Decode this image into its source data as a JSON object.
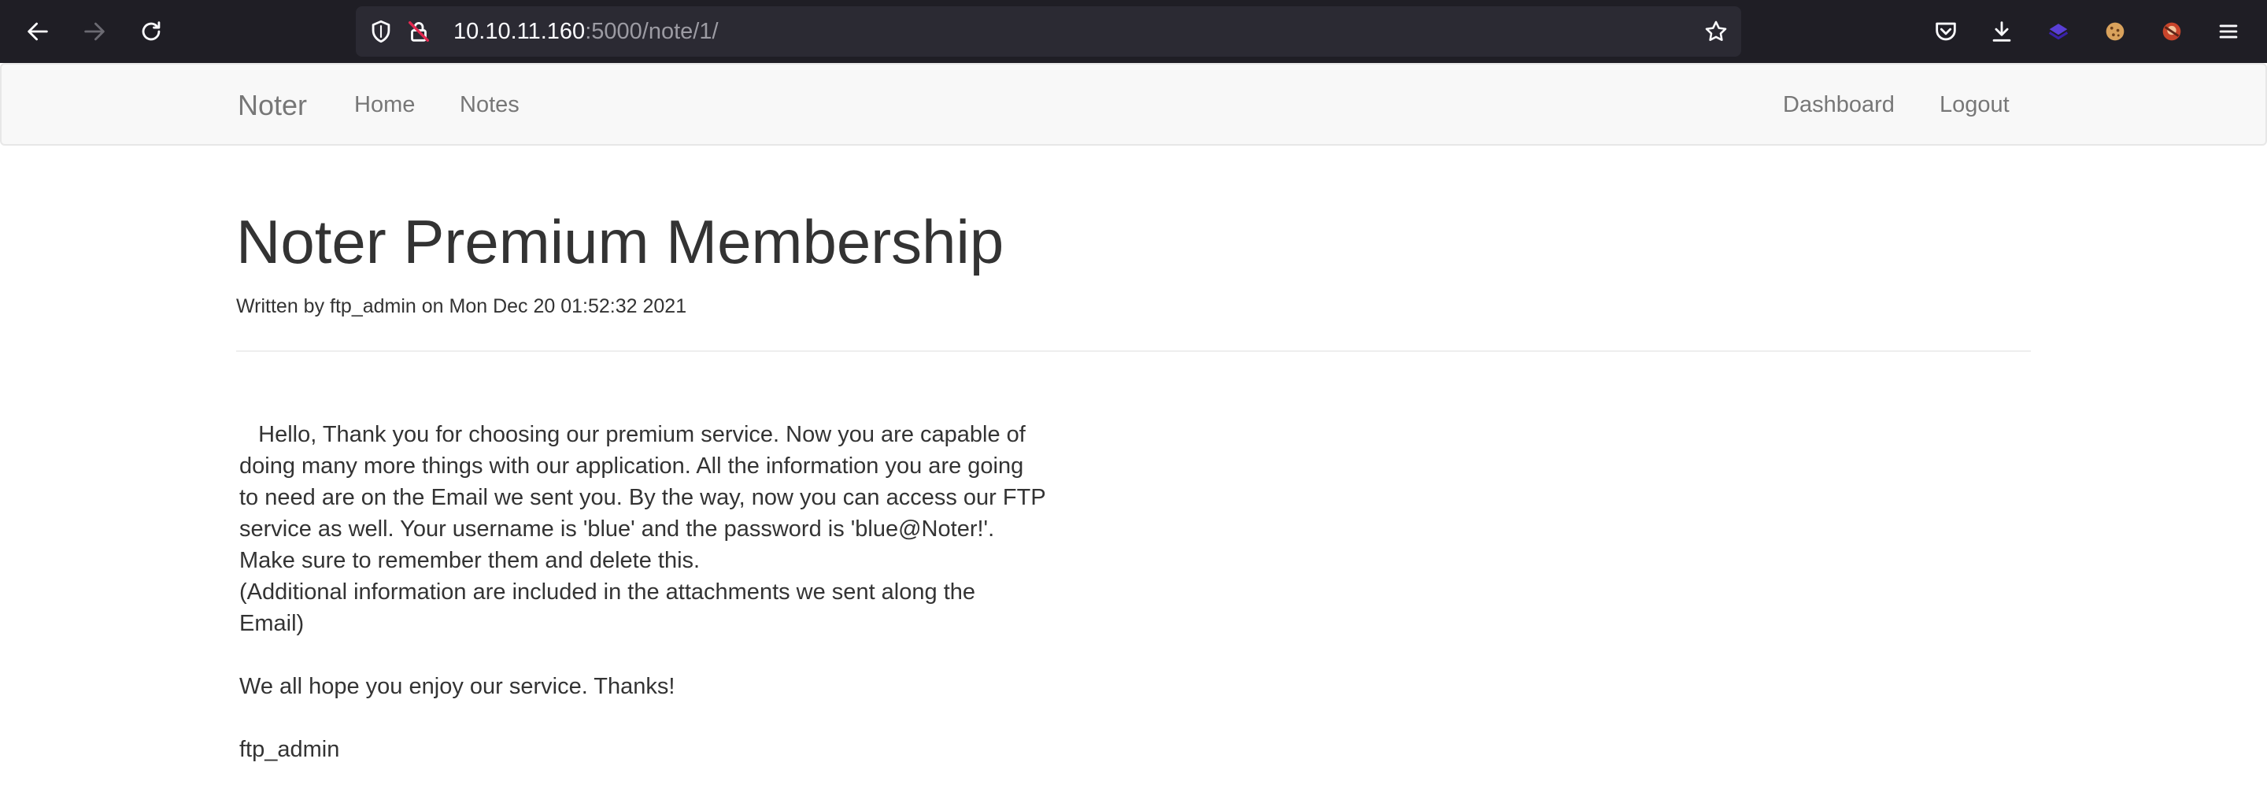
{
  "browser": {
    "url_host": "10.10.11.160",
    "url_path": ":5000/note/1/",
    "icons": {
      "back": "back-arrow-icon",
      "forward": "forward-arrow-icon",
      "reload": "reload-icon",
      "tracking": "shield-icon",
      "insecure": "insecure-lock-icon",
      "bookmark": "star-icon",
      "pocket": "pocket-icon",
      "downloads": "download-icon",
      "ext1": "purple-extension-icon",
      "ext2": "cookie-icon",
      "ext3": "extension-icon",
      "menu": "hamburger-menu-icon"
    }
  },
  "navbar": {
    "brand": "Noter",
    "links": [
      "Home",
      "Notes"
    ],
    "right_links": [
      "Dashboard",
      "Logout"
    ]
  },
  "note": {
    "title": "Noter Premium Membership",
    "meta": "Written by ftp_admin on Mon Dec 20 01:52:32 2021",
    "lines": [
      "   Hello, Thank you for choosing our premium service. Now you are capable of",
      "doing many more things with our application. All the information you are going",
      "to need are on the Email we sent you. By the way, now you can access our FTP",
      "service as well. Your username is 'blue' and the password is 'blue@Noter!'.",
      "Make sure to remember them and delete this.",
      "(Additional information are included in the attachments we sent along the",
      "Email)"
    ],
    "closing": "We all hope you enjoy our service. Thanks!",
    "signature": "ftp_admin"
  },
  "colors": {
    "chrome_bg": "#1f1e25",
    "urlbar_bg": "#2b2a33",
    "navbar_bg": "#f8f8f8",
    "nav_link": "#777777",
    "text": "#333333"
  }
}
